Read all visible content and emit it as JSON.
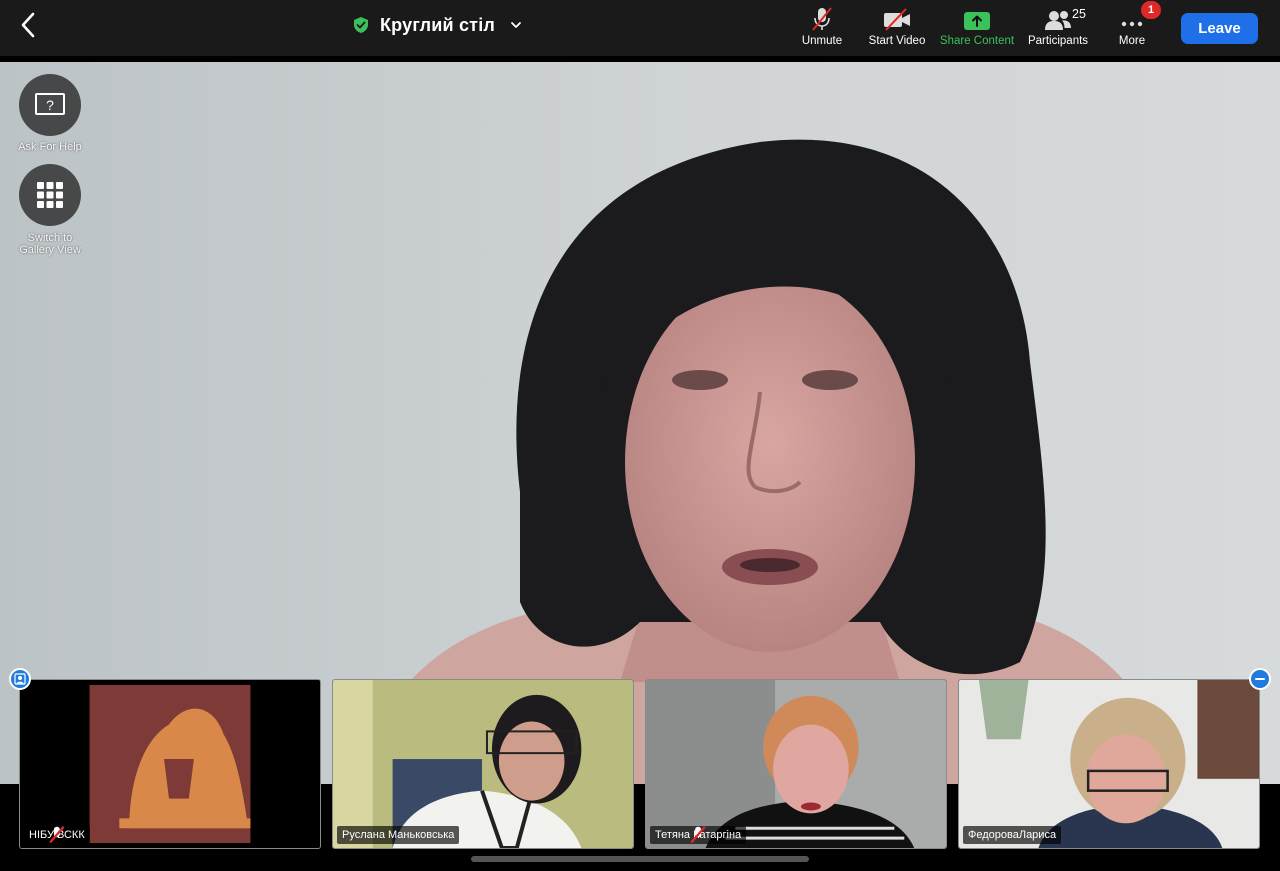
{
  "header": {
    "meeting_title": "Круглий стіл",
    "toolbar": {
      "unmute_label": "Unmute",
      "start_video_label": "Start Video",
      "share_content_label": "Share Content",
      "participants_label": "Participants",
      "participants_count": "25",
      "more_label": "More",
      "more_badge": "1",
      "leave_label": "Leave"
    }
  },
  "side_controls": {
    "ask_for_help_label": "Ask For Help",
    "switch_view_label_line1": "Switch to",
    "switch_view_label_line2": "Gallery View"
  },
  "participants": [
    {
      "name": "НІБУ ВСКК",
      "muted": true
    },
    {
      "name": "Руслана Маньковська",
      "muted": false
    },
    {
      "name": "Тетяна Катаргіна",
      "muted": true
    },
    {
      "name": "ФедороваЛариса",
      "muted": false
    }
  ],
  "colors": {
    "share_green": "#3cc15a",
    "leave_blue": "#1f6fe8",
    "badge_red": "#e02828",
    "topbar_bg": "#1a1a1a"
  },
  "icons": {
    "back": "chevron-left-icon",
    "security": "shield-check-icon",
    "title_dropdown": "chevron-down-icon",
    "unmute": "microphone-off-icon",
    "start_video": "video-off-icon",
    "share": "share-arrow-icon",
    "participants": "people-icon",
    "more": "ellipsis-icon",
    "ask_for_help": "help-question-icon",
    "switch_view": "grid-icon"
  }
}
